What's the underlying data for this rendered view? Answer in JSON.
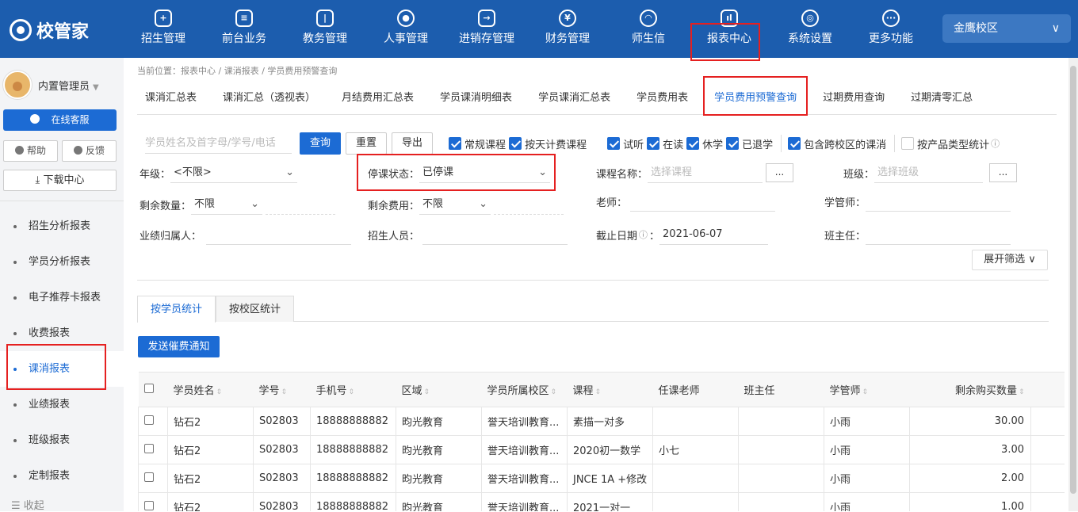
{
  "app": {
    "logo_text": "校管家"
  },
  "nav": [
    {
      "label": "招生管理",
      "icon": "recruit-icon"
    },
    {
      "label": "前台业务",
      "icon": "frontdesk-icon"
    },
    {
      "label": "教务管理",
      "icon": "academic-icon"
    },
    {
      "label": "人事管理",
      "icon": "personnel-icon"
    },
    {
      "label": "进销存管理",
      "icon": "inventory-icon"
    },
    {
      "label": "财务管理",
      "icon": "finance-icon"
    },
    {
      "label": "师生信",
      "icon": "message-icon"
    },
    {
      "label": "报表中心",
      "icon": "report-icon"
    },
    {
      "label": "系统设置",
      "icon": "settings-icon"
    },
    {
      "label": "更多功能",
      "icon": "more-icon"
    }
  ],
  "campus": {
    "label": "金鹰校区"
  },
  "sidebar": {
    "user": "内置管理员",
    "service": "在线客服",
    "help": "帮助",
    "feedback": "反馈",
    "download": "下载中心",
    "menu": [
      "招生分析报表",
      "学员分析报表",
      "电子推荐卡报表",
      "收费报表",
      "课消报表",
      "业绩报表",
      "班级报表",
      "定制报表"
    ],
    "collapse": "收起"
  },
  "breadcrumb": "当前位置：报表中心 / 课消报表 / 学员费用预警查询",
  "tabs": [
    "课消汇总表",
    "课消汇总（透视表）",
    "月结费用汇总表",
    "学员课消明细表",
    "学员课消汇总表",
    "学员费用表",
    "学员费用预警查询",
    "过期费用查询",
    "过期清零汇总"
  ],
  "toolbar": {
    "search_placeholder": "学员姓名及首字母/学号/电话",
    "query": "查询",
    "reset": "重置",
    "export": "导出"
  },
  "checkboxes": [
    {
      "label": "常规课程",
      "checked": true
    },
    {
      "label": "按天计费课程",
      "checked": true
    },
    {
      "label": "试听",
      "checked": true
    },
    {
      "label": "在读",
      "checked": true
    },
    {
      "label": "休学",
      "checked": true
    },
    {
      "label": "已退学",
      "checked": true
    },
    {
      "label": "包含跨校区的课消",
      "checked": true
    },
    {
      "label": "按产品类型统计",
      "checked": false
    }
  ],
  "filters": {
    "grade_label": "年级：",
    "grade_value": "<不限>",
    "stop_label": "停课状态：",
    "stop_value": "已停课",
    "course_label": "课程名称：",
    "course_placeholder": "选择课程",
    "class_label": "班级：",
    "class_placeholder": "选择班级",
    "remain_qty_label": "剩余数量：",
    "remain_qty_value": "不限",
    "remain_fee_label": "剩余费用：",
    "remain_fee_value": "不限",
    "teacher_label": "老师：",
    "manager_label": "学管师：",
    "owner_label": "业绩归属人：",
    "recruiter_label": "招生人员：",
    "deadline_label": "截止日期",
    "deadline_value": "2021-06-07",
    "head_label": "班主任：",
    "dots": "...",
    "expand": "展开筛选"
  },
  "subtabs": [
    "按学员统计",
    "按校区统计"
  ],
  "notify_button": "发送催费通知",
  "table": {
    "headers": [
      "学员姓名",
      "学号",
      "手机号",
      "区域",
      "学员所属校区",
      "课程",
      "任课老师",
      "班主任",
      "学管师",
      "剩余购买数量"
    ],
    "rows": [
      [
        "钻石2",
        "S02803",
        "18888888882",
        "昀光教育",
        "誉天培训教育...",
        "素描一对多",
        "",
        "",
        "小雨",
        "30.00"
      ],
      [
        "钻石2",
        "S02803",
        "18888888882",
        "昀光教育",
        "誉天培训教育...",
        "2020初一数学",
        "小七",
        "",
        "小雨",
        "3.00"
      ],
      [
        "钻石2",
        "S02803",
        "18888888882",
        "昀光教育",
        "誉天培训教育...",
        "JNCE 1A +修改",
        "",
        "",
        "小雨",
        "2.00"
      ],
      [
        "钻石2",
        "S02803",
        "18888888882",
        "昀光教育",
        "誉天培训教育...",
        "2021一对一",
        "",
        "",
        "小雨",
        "1.00"
      ]
    ]
  },
  "colors": {
    "primary": "#1c6bd4",
    "topbar": "#1c5dae",
    "highlight": "#e52020"
  }
}
